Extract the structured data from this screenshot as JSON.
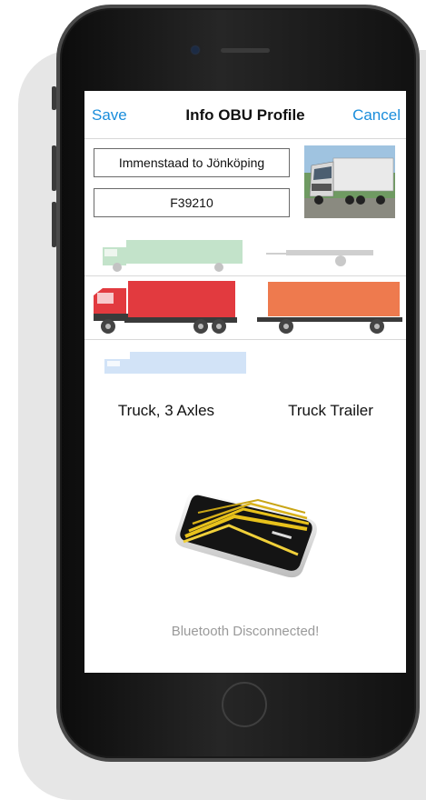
{
  "navbar": {
    "save_label": "Save",
    "title": "Info OBU Profile",
    "cancel_label": "Cancel"
  },
  "profile": {
    "route_value": "Immenstaad to Jönköping",
    "plate_value": "F39210"
  },
  "vehicles": {
    "selected_vehicle_label": "Truck, 3 Axles",
    "selected_trailer_label": "Truck Trailer"
  },
  "status": {
    "bluetooth_text": "Bluetooth Disconnected!"
  },
  "colors": {
    "accent": "#1a8ddb",
    "selected_truck": "#e23a3f",
    "selected_trailer": "#ee7a4e",
    "faded_truck_above": "#57b06a",
    "faded_truck_below": "#7fb2ea"
  }
}
